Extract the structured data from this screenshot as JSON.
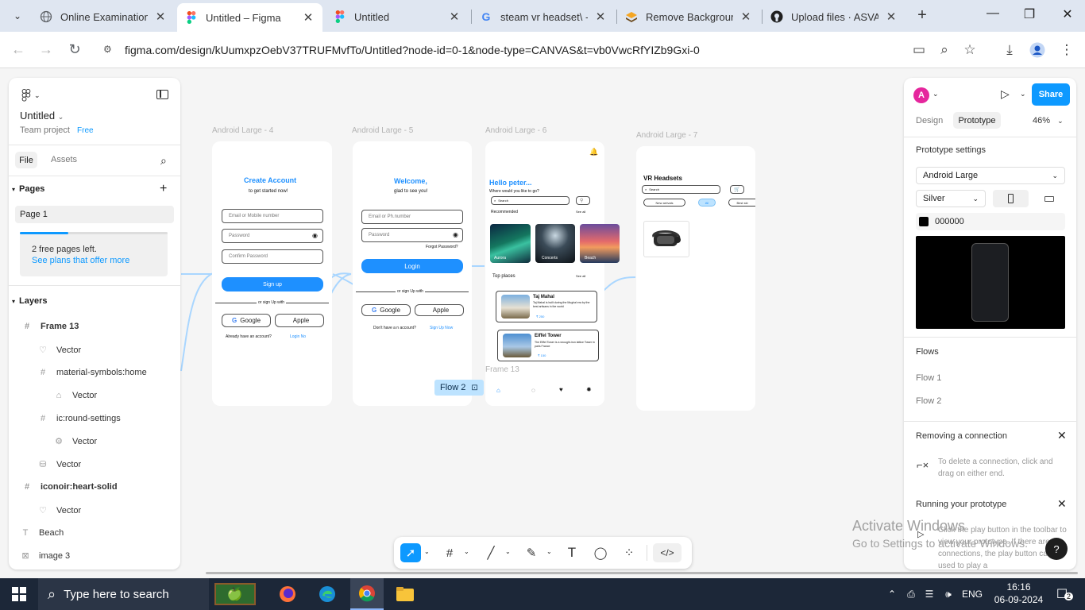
{
  "browser": {
    "tabs": [
      {
        "title": "Online Examination S",
        "favicon": "globe-icon"
      },
      {
        "title": "Untitled – Figma",
        "favicon": "figma-icon",
        "active": true
      },
      {
        "title": "Untitled",
        "favicon": "figma-icon"
      },
      {
        "title": "steam vr headset\\ - G",
        "favicon": "google-icon"
      },
      {
        "title": "Remove Background",
        "favicon": "removebg-icon"
      },
      {
        "title": "Upload files · ASVATH",
        "favicon": "github-icon"
      }
    ],
    "url": "figma.com/design/kUumxpzOebV37TRUFMvfTo/Untitled?node-id=0-1&node-type=CANVAS&t=vb0VwcRfYIZb9Gxi-0"
  },
  "left_panel": {
    "file_name": "Untitled",
    "team": "Team project",
    "plan": "Free",
    "tabs": [
      "File",
      "Assets"
    ],
    "pages_label": "Pages",
    "page": "Page 1",
    "free_pages_text": "2 free pages left.",
    "plans_link": "See plans that offer more",
    "free_pages_progress": 0.33,
    "layers_label": "Layers",
    "layers": [
      {
        "name": "Frame 13",
        "icon": "frame-icon",
        "depth": 0,
        "bold": true
      },
      {
        "name": "Vector",
        "icon": "heart-outline-icon",
        "depth": 1
      },
      {
        "name": "material-symbols:home",
        "icon": "frame-icon",
        "depth": 1
      },
      {
        "name": "Vector",
        "icon": "home-icon",
        "depth": 2
      },
      {
        "name": "ic:round-settings",
        "icon": "frame-icon",
        "depth": 1
      },
      {
        "name": "Vector",
        "icon": "settings-icon",
        "depth": 2
      },
      {
        "name": "Vector",
        "icon": "bag-icon",
        "depth": 1
      },
      {
        "name": "iconoir:heart-solid",
        "icon": "frame-icon",
        "depth": 0,
        "bold": true
      },
      {
        "name": "Vector",
        "icon": "heart-outline-icon",
        "depth": 1
      },
      {
        "name": "Beach",
        "icon": "text-icon",
        "depth": 0
      },
      {
        "name": "image 3",
        "icon": "image-icon",
        "depth": 0
      }
    ]
  },
  "canvas": {
    "frames": {
      "f4": {
        "label": "Android Large - 4",
        "title": "Create Account",
        "subtitle": "to get started now!",
        "email_ph": "Email or Mobile number",
        "password_ph": "Password",
        "confirm_ph": "Confirm Password",
        "signup_btn": "Sign up",
        "or_text": "or sign Up with",
        "google": "Google",
        "apple": "Apple",
        "footer": "Already have an account?",
        "footer_link": "Login No"
      },
      "f5": {
        "label": "Android Large - 5",
        "title": "Welcome,",
        "subtitle": "glad to see you!",
        "email_ph": "Email or Ph.number",
        "password_ph": "Password",
        "forgot": "Forgot Password?",
        "login_btn": "Login",
        "or_text": "or sign Up with",
        "google": "Google",
        "apple": "Apple",
        "footer": "Don't have a n account?",
        "footer_link": "Sign Up Now"
      },
      "f6": {
        "label": "Android Large - 6",
        "hello": "Hello peter...",
        "question": "Where would you like to go?",
        "search": "Search",
        "recommended": "Recommended",
        "see_all": "See all",
        "cards": [
          "Aurora",
          "Concerts",
          "Beach"
        ],
        "top_places": "Top places",
        "places": [
          {
            "name": "Taj Mahal",
            "desc": "Taj Mahal is built during the Mughal era by the best artisans in the world",
            "price": "₹ 250"
          },
          {
            "name": "Eiffel Tower",
            "desc": "The Eiffel Tower is a wrought-iron lattice Tower in paris France",
            "price": "₹ 150"
          }
        ],
        "frame13_label": "Frame 13"
      },
      "f7": {
        "label": "Android Large - 7",
        "title": "VR Headsets",
        "search": "Search",
        "chips": [
          "New arrivals",
          "All",
          "Best ski"
        ]
      }
    },
    "flow_chip": "Flow 2"
  },
  "right_panel": {
    "avatar": "A",
    "share": "Share",
    "tabs": [
      "Design",
      "Prototype"
    ],
    "zoom": "46%",
    "prototype_settings": "Prototype settings",
    "device": "Android Large",
    "model": "Silver",
    "bg_color": "000000",
    "flows_label": "Flows",
    "flows": [
      "Flow 1",
      "Flow 2"
    ],
    "removing_title": "Removing a connection",
    "removing_desc": "To delete a connection, click and drag on either end.",
    "running_title": "Running your prototype",
    "running_desc": "Click the play button in the toolbar to view your prototype. If there are no connections, the play button can be used to play a"
  },
  "watermark": {
    "line1": "Activate Windows",
    "line2": "Go to Settings to activate Windows."
  },
  "taskbar": {
    "search_placeholder": "Type here to search",
    "language": "ENG",
    "time": "16:16",
    "date": "06-09-2024",
    "notif_count": "2"
  },
  "colors": {
    "figma_blue": "#0d99ff",
    "accent_blue": "#1e90ff",
    "taskbar": "#1c2738"
  }
}
